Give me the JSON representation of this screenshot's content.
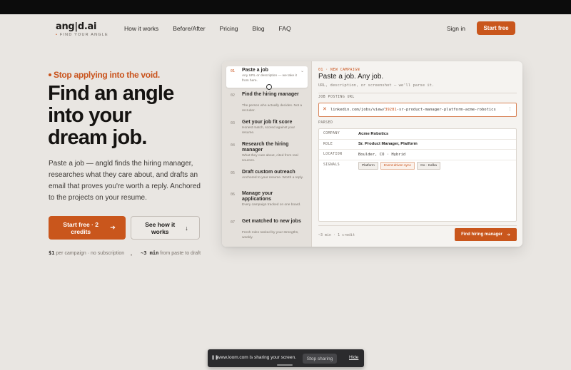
{
  "nav": {
    "logo": "ang|d.ai",
    "tagline": "FIND YOUR ANGLE",
    "links": [
      "How it works",
      "Before/After",
      "Pricing",
      "Blog",
      "FAQ"
    ],
    "signin": "Sign in",
    "start_free": "Start free"
  },
  "hero": {
    "eyebrow": "Stop applying into the void.",
    "headline": [
      "Find an angle",
      "into your",
      "dream job."
    ],
    "subtext": "Paste a job — angld finds the hiring manager, researches what they care about, and drafts an email that proves you're worth a reply. Anchored to the projects on your resume.",
    "cta_primary": "Start free · 2 credits",
    "cta_secondary": "See how it works",
    "stat1_value": "$1",
    "stat1_text": "per campaign · no subscription",
    "stat_sep": "•",
    "stat2_value": "~3 min",
    "stat2_text": "from paste to draft"
  },
  "steps": [
    {
      "num": "01",
      "title": "Paste a job",
      "desc": "Any URL or description — we take it from here."
    },
    {
      "num": "02",
      "title": "Find the hiring manager",
      "desc": "The person who actually decides. Not a recruiter."
    },
    {
      "num": "03",
      "title": "Get your job fit score",
      "desc": "Honest match, scored against your resume."
    },
    {
      "num": "04",
      "title": "Research the hiring manager",
      "desc": "What they care about, cited from real sources."
    },
    {
      "num": "05",
      "title": "Draft custom outreach",
      "desc": "Anchored to your resume. Worth a reply."
    },
    {
      "num": "06",
      "title": "Manage your applications",
      "desc": "Every campaign tracked on one board."
    },
    {
      "num": "07",
      "title": "Get matched to new jobs",
      "desc": "Fresh roles ranked by your strengths, weekly."
    }
  ],
  "pane": {
    "eyebrow": "01 · NEW CAMPAIGN",
    "title": "Paste a job. Any job.",
    "subtitle": "URL, description, or screenshot — we'll parse it.",
    "url_label": "JOB POSTING URL",
    "url_prefix": "linkedin.com/jobs/view/",
    "url_id": "39281",
    "url_suffix": "-sr-product-manager-platform-acme-robotics",
    "parsed_label": "PARSED",
    "rows": [
      {
        "key": "COMPANY",
        "value": "Acme Robotics"
      },
      {
        "key": "ROLE",
        "value": "Sr. Product Manager, Platform"
      },
      {
        "key": "LOCATION",
        "value": "Boulder, CO · Hybrid"
      },
      {
        "key": "SIGNALS",
        "value": ""
      }
    ],
    "signals": [
      "Platform",
      "Event-driven sync",
      "Go · Kafka"
    ],
    "footer": "~3 min · 1 credit",
    "find_button": "Find hiring manager"
  },
  "loom": {
    "text": "www.loom.com is sharing your screen.",
    "stop": "Stop sharing",
    "hide": "Hide"
  },
  "colors": {
    "accent": "#c9561c",
    "background": "#e9e6e2"
  }
}
